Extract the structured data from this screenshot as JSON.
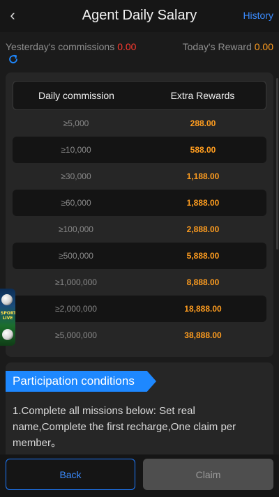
{
  "header": {
    "back_icon": "chevron-left-icon",
    "title": "Agent Daily Salary",
    "history_label": "History"
  },
  "summary": {
    "yesterday_label": "Yesterday's commissions",
    "yesterday_value": "0.00",
    "today_label": "Today's Reward",
    "today_value": "0.00",
    "refresh_icon": "refresh-icon"
  },
  "table": {
    "col1": "Daily commission",
    "col2": "Extra Rewards",
    "rows": [
      {
        "commission": "≥5,000",
        "reward": "288.00"
      },
      {
        "commission": "≥10,000",
        "reward": "588.00"
      },
      {
        "commission": "≥30,000",
        "reward": "1,188.00"
      },
      {
        "commission": "≥60,000",
        "reward": "1,888.00"
      },
      {
        "commission": "≥100,000",
        "reward": "2,888.00"
      },
      {
        "commission": "≥500,000",
        "reward": "5,888.00"
      },
      {
        "commission": "≥1,000,000",
        "reward": "8,888.00"
      },
      {
        "commission": "≥2,000,000",
        "reward": "18,888.00"
      },
      {
        "commission": "≥5,000,000",
        "reward": "38,888.00"
      }
    ]
  },
  "side_widget": {
    "text": "SPORTS LIVE"
  },
  "conditions": {
    "title": "Participation conditions",
    "text": "1.Complete all missions below: Set real name,Complete the first recharge,One claim per member。"
  },
  "footer": {
    "back_label": "Back",
    "claim_label": "Claim"
  },
  "colors": {
    "accent": "#1e88ff",
    "reward": "#ff9d1f",
    "negative": "#ff3b30"
  }
}
